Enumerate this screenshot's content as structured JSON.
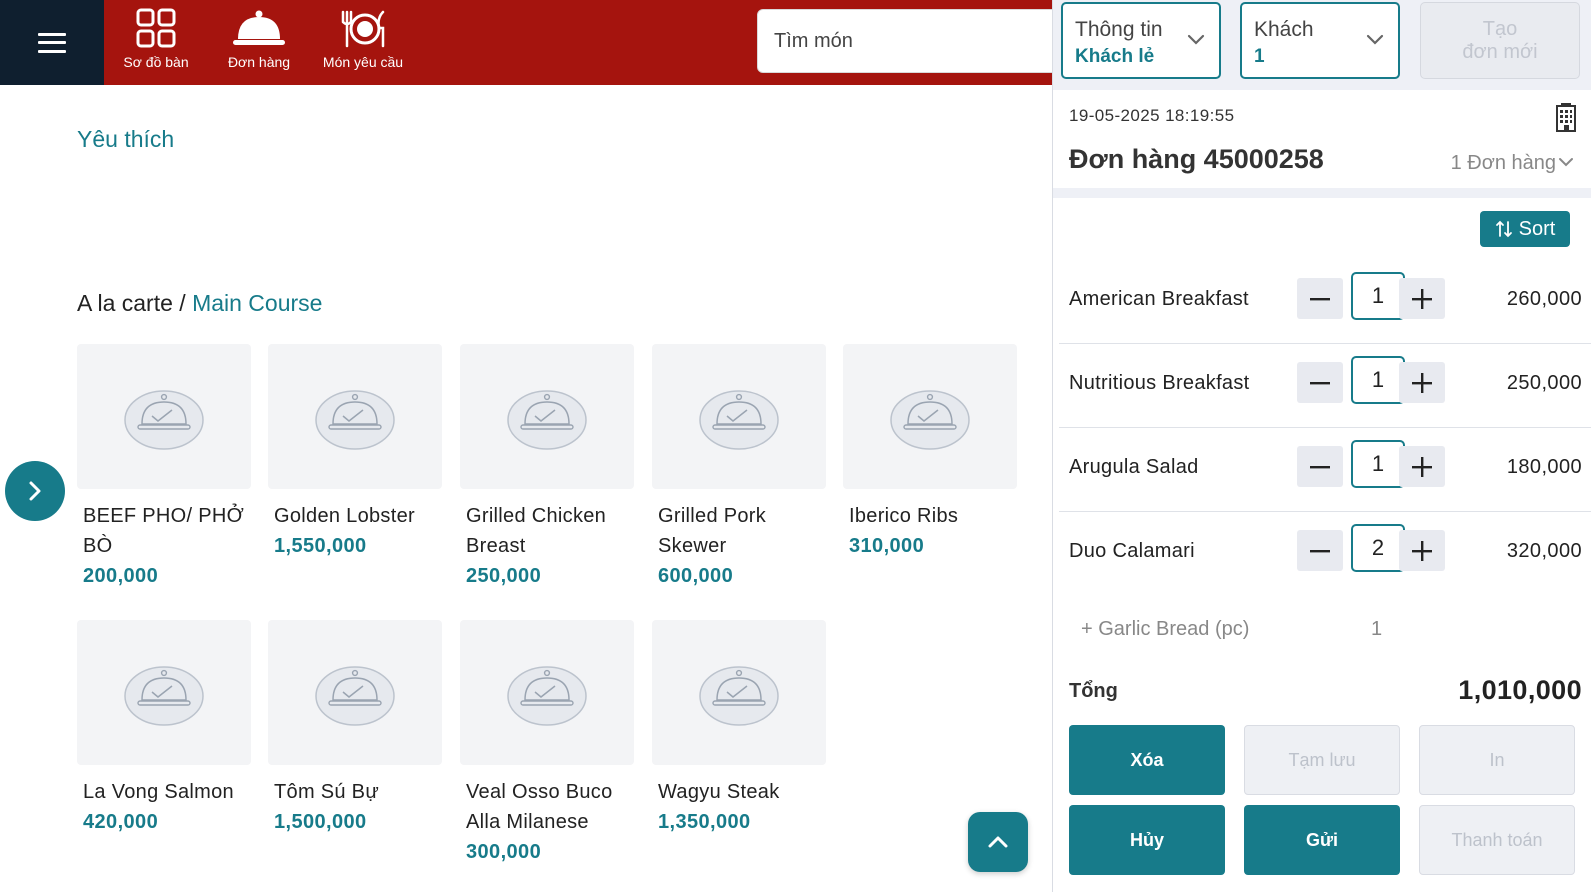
{
  "header": {
    "nav": [
      {
        "label": "Sơ đồ bàn",
        "icon": "grid-icon"
      },
      {
        "label": "Đơn hàng",
        "icon": "cloche-icon"
      },
      {
        "label": "Món yêu cầu",
        "icon": "dining-icon"
      }
    ],
    "search_placeholder": "Tìm món"
  },
  "main": {
    "favorites_title": "Yêu thích",
    "breadcrumb": {
      "root": "A la carte",
      "sep": " / ",
      "current": "Main Course"
    },
    "products": [
      {
        "name": "BEEF PHO/ PHỞ BÒ",
        "price": "200,000"
      },
      {
        "name": "Golden Lobster",
        "price": "1,550,000"
      },
      {
        "name": "Grilled Chicken Breast",
        "price": "250,000"
      },
      {
        "name": "Grilled Pork Skewer",
        "price": "600,000"
      },
      {
        "name": "Iberico Ribs",
        "price": "310,000"
      },
      {
        "name": "La Vong Salmon",
        "price": "420,000"
      },
      {
        "name": "Tôm Sú Bự",
        "price": "1,500,000"
      },
      {
        "name": "Veal Osso Buco Alla Milanese",
        "price": "300,000"
      },
      {
        "name": "Wagyu Steak",
        "price": "1,350,000"
      }
    ]
  },
  "order": {
    "info_dropdown": {
      "label": "Thông tin",
      "value": "Khách lẻ"
    },
    "guest_dropdown": {
      "label": "Khách",
      "value": "1"
    },
    "new_order_line1": "Tạo",
    "new_order_line2": "đơn mới",
    "datetime": "19-05-2025 18:19:55",
    "title": "Đơn hàng 45000258",
    "count": "1 Đơn hàng",
    "sort_label": "Sort",
    "items": [
      {
        "name": "American Breakfast",
        "qty": "1",
        "amount": "260,000"
      },
      {
        "name": "Nutritious Breakfast",
        "qty": "1",
        "amount": "250,000"
      },
      {
        "name": "Arugula Salad",
        "qty": "1",
        "amount": "180,000"
      },
      {
        "name": "Duo Calamari",
        "qty": "2",
        "amount": "320,000"
      }
    ],
    "modifier": {
      "name": "+ Garlic Bread (pc)",
      "qty": "1"
    },
    "total_label": "Tổng",
    "total_value": "1,010,000",
    "buttons": {
      "delete": "Xóa",
      "hold": "Tạm lưu",
      "print": "In",
      "cancel": "Hủy",
      "send": "Gửi",
      "pay": "Thanh toán"
    }
  },
  "colors": {
    "brand_red": "#a5140e",
    "accent_teal": "#177b8a",
    "dark_navy": "#0f1f2f"
  }
}
